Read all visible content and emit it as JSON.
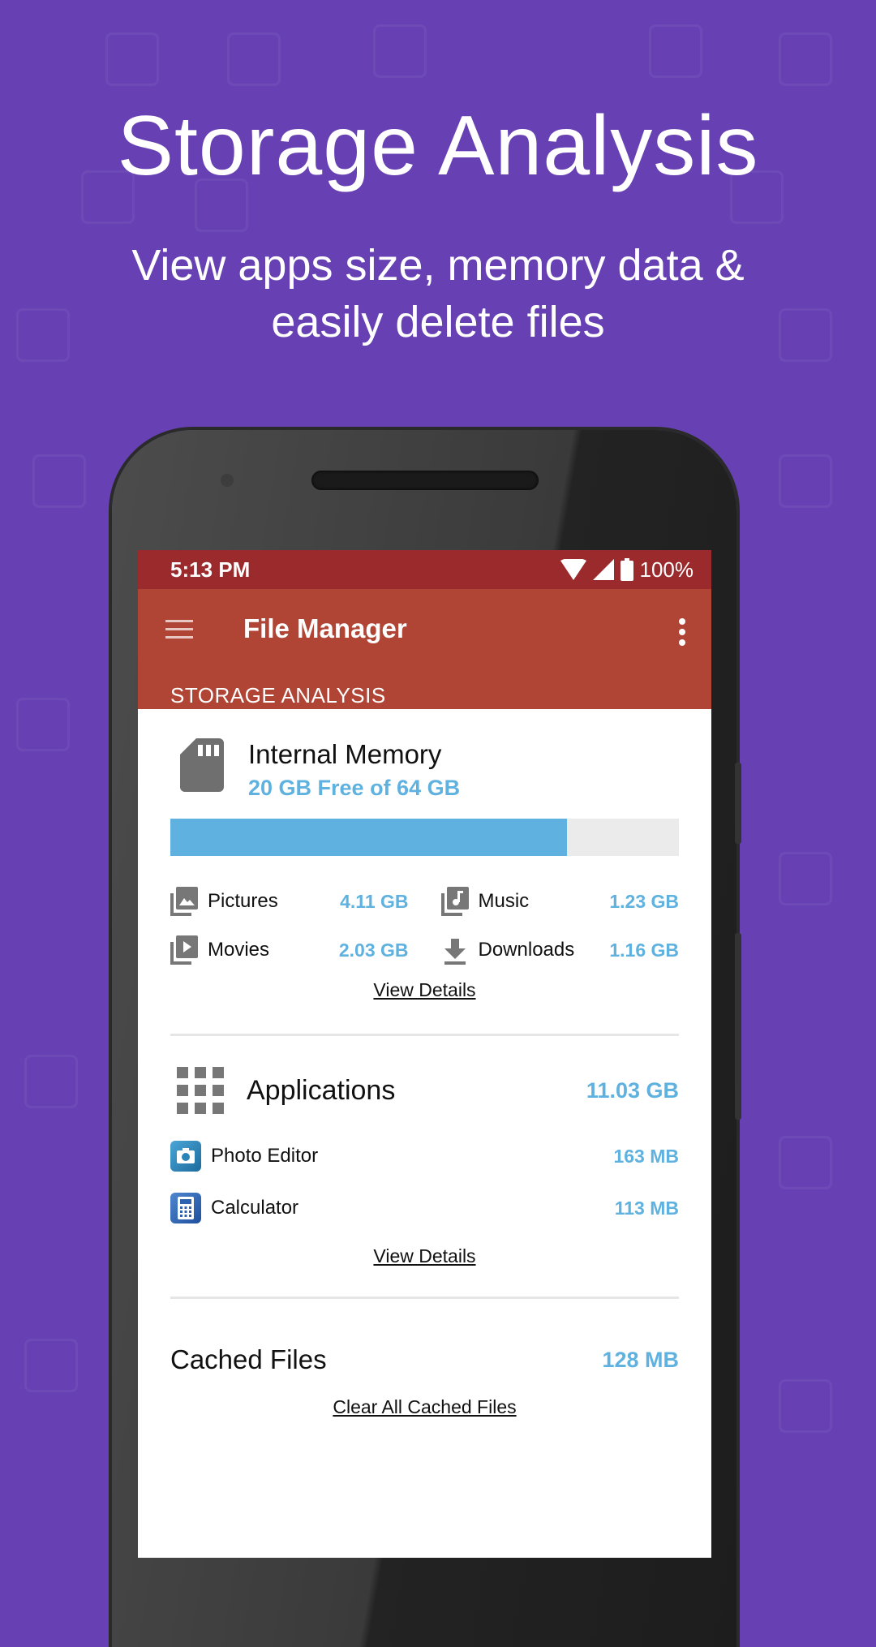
{
  "hero": {
    "title": "Storage Analysis",
    "subtitle_line1": "View apps size, memory data &",
    "subtitle_line2": "easily delete files"
  },
  "status_bar": {
    "time": "5:13 PM",
    "battery": "100%"
  },
  "app_bar": {
    "title": "File Manager",
    "section_title": "STORAGE ANALYSIS"
  },
  "internal_memory": {
    "title": "Internal Memory",
    "free_text": "20 GB Free of 64 GB",
    "used_fraction": 0.78,
    "categories": [
      {
        "name": "Pictures",
        "size": "4.11 GB",
        "icon": "pictures-icon"
      },
      {
        "name": "Music",
        "size": "1.23 GB",
        "icon": "music-icon"
      },
      {
        "name": "Movies",
        "size": "2.03 GB",
        "icon": "movies-icon"
      },
      {
        "name": "Downloads",
        "size": "1.16 GB",
        "icon": "download-icon"
      }
    ],
    "view_details": "View Details"
  },
  "applications": {
    "title": "Applications",
    "total": "11.03 GB",
    "apps": [
      {
        "name": "Photo Editor",
        "size": "163 MB",
        "icon": "camera-app-icon"
      },
      {
        "name": "Calculator",
        "size": "113 MB",
        "icon": "calculator-app-icon"
      }
    ],
    "view_details": "View Details"
  },
  "cached_files": {
    "title": "Cached Files",
    "size": "128 MB",
    "clear_label": "Clear All Cached Files"
  },
  "colors": {
    "background": "#6741b4",
    "status_bar": "#9b2a2d",
    "app_bar": "#b14535",
    "accent": "#5fb2df"
  }
}
